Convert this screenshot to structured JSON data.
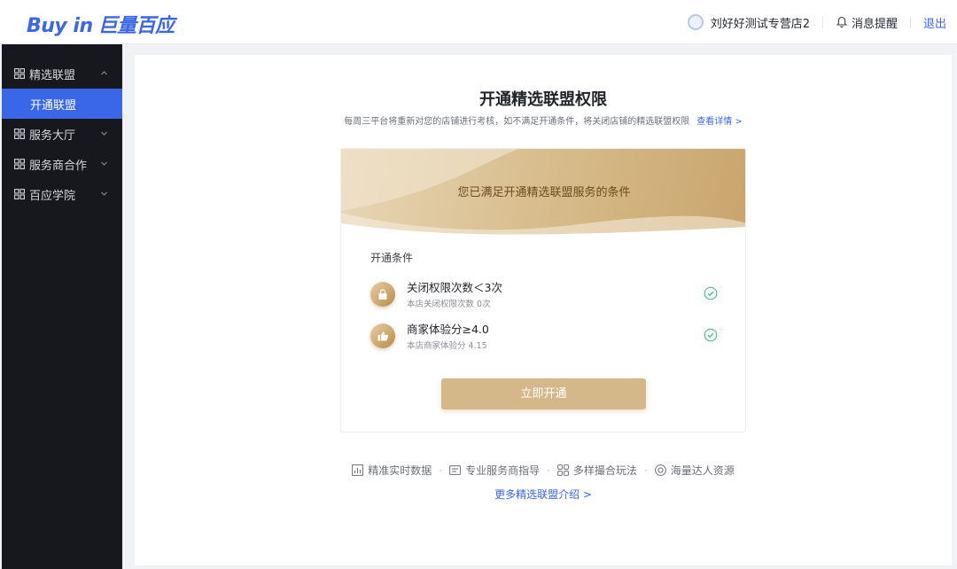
{
  "brand": {
    "logo_text": "Buy in",
    "logo_cn": "巨量百应"
  },
  "header": {
    "store_name": "刘好好测试专营店2",
    "notifications_label": "消息提醒",
    "logout_label": "退出"
  },
  "sidebar": {
    "items": [
      {
        "label": "精选联盟",
        "expanded": true,
        "sub": [
          {
            "label": "开通联盟",
            "active": true
          }
        ]
      },
      {
        "label": "服务大厅"
      },
      {
        "label": "服务商合作"
      },
      {
        "label": "百应学院"
      }
    ]
  },
  "main": {
    "title": "开通精选联盟权限",
    "subtitle": "每周三平台将重新对您的店铺进行考核，如不满足开通条件，将关闭店铺的精选联盟权限",
    "detail_link": "查看详情 >",
    "banner_text": "您已满足开通精选联盟服务的条件",
    "conditions_title": "开通条件",
    "conditions": [
      {
        "icon": "lock-icon",
        "name": "关闭权限次数＜3次",
        "desc": "本店关闭权限次数 0次",
        "status": "met"
      },
      {
        "icon": "thumbs-up-icon",
        "name": "商家体验分≥4.0",
        "desc": "本店商家体验分 4.15",
        "status": "met"
      }
    ],
    "open_button": "立即开通",
    "features": [
      {
        "icon": "chart-icon",
        "label": "精准实时数据"
      },
      {
        "icon": "document-icon",
        "label": "专业服务商指导"
      },
      {
        "icon": "grid-icon",
        "label": "多样撮合玩法"
      },
      {
        "icon": "target-icon",
        "label": "海量达人资源"
      }
    ],
    "more_link": "更多精选联盟介绍 >"
  },
  "colors": {
    "primary": "#3a66e8",
    "gold": "#d5b88a",
    "sidebar_bg": "#16181d",
    "check": "#2fb87a"
  }
}
